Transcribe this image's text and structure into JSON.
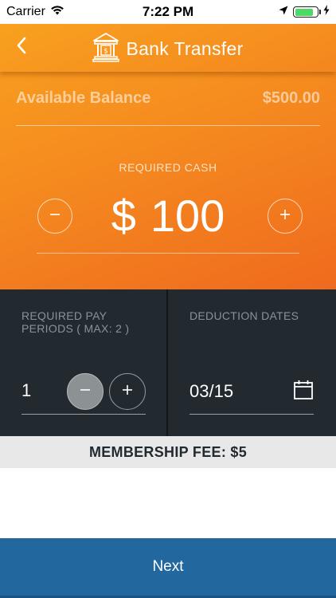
{
  "status_bar": {
    "carrier": "Carrier",
    "time": "7:22 PM",
    "battery_level": 0.85,
    "battery_color": "#4cd964",
    "icons": [
      "wifi-icon",
      "location-arrow-icon",
      "battery-icon",
      "charging-bolt-icon"
    ]
  },
  "nav": {
    "title": "Bank Transfer",
    "back_icon": "chevron-left-icon",
    "title_icon": "bank-icon"
  },
  "balance": {
    "label": "Available Balance",
    "value": "$500.00"
  },
  "cash": {
    "label": "REQUIRED CASH",
    "currency": "$",
    "amount": "100",
    "minus_icon": "minus-icon",
    "plus_icon": "plus-icon"
  },
  "pay_periods": {
    "label": "REQUIRED PAY PERIODS ( MAX: 2 )",
    "value": "1",
    "minus_icon": "minus-icon",
    "plus_icon": "plus-icon"
  },
  "deduction": {
    "label": "DEDUCTION DATES",
    "value": "03/15",
    "icon": "calendar-icon"
  },
  "fee": {
    "text": "MEMBERSHIP FEE: $5"
  },
  "next_button": {
    "label": "Next"
  },
  "colors": {
    "orange_light": "#f9a11f",
    "orange_dark": "#ef6a1e",
    "dark_panel": "#222a30",
    "fee_bar": "#e8e8e8",
    "next_blue": "#23679f"
  }
}
